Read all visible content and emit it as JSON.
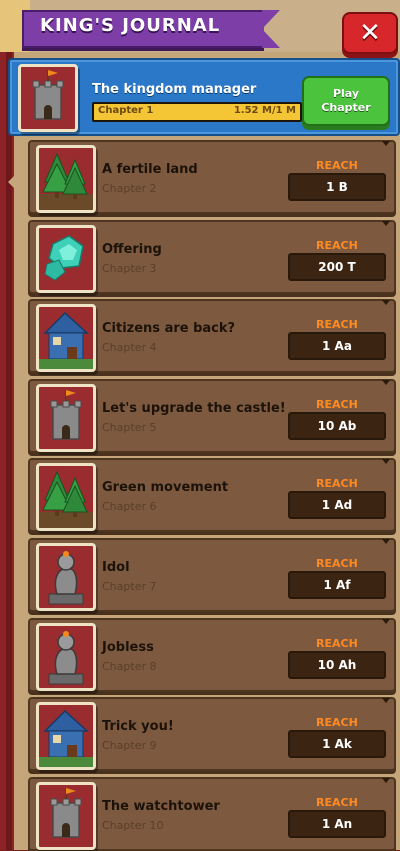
{
  "header": {
    "title": "KING'S JOURNAL",
    "close_icon": "close-icon"
  },
  "active_chapter": {
    "icon": "castle-icon",
    "title": "The kingdom manager",
    "chapter_label": "Chapter 1",
    "progress_text": "1.52 M/1 M",
    "progress_fraction": 1.0,
    "play_label_line1": "Play",
    "play_label_line2": "Chapter"
  },
  "chapters": [
    {
      "title": "A fertile land",
      "chapter": "Chapter 2",
      "reach_label": "REACH",
      "value": "1 B",
      "icon": "trees-icon"
    },
    {
      "title": "Offering",
      "chapter": "Chapter 3",
      "reach_label": "REACH",
      "value": "200 T",
      "icon": "gem-icon"
    },
    {
      "title": "Citizens are back?",
      "chapter": "Chapter 4",
      "reach_label": "REACH",
      "value": "1 Aa",
      "icon": "house-icon"
    },
    {
      "title": "Let's upgrade the castle!",
      "chapter": "Chapter 5",
      "reach_label": "REACH",
      "value": "10 Ab",
      "icon": "castle-icon"
    },
    {
      "title": "Green movement",
      "chapter": "Chapter 6",
      "reach_label": "REACH",
      "value": "1 Ad",
      "icon": "trees-icon"
    },
    {
      "title": "Idol",
      "chapter": "Chapter 7",
      "reach_label": "REACH",
      "value": "1 Af",
      "icon": "statue-icon"
    },
    {
      "title": "Jobless",
      "chapter": "Chapter 8",
      "reach_label": "REACH",
      "value": "10 Ah",
      "icon": "statue-icon"
    },
    {
      "title": "Trick you!",
      "chapter": "Chapter 9",
      "reach_label": "REACH",
      "value": "1 Ak",
      "icon": "house-icon"
    },
    {
      "title": "The watchtower",
      "chapter": "Chapter 10",
      "reach_label": "REACH",
      "value": "1 An",
      "icon": "castle-icon"
    }
  ],
  "colors": {
    "ribbon": "#7d3ea8",
    "close": "#d8272b",
    "active_card": "#2c78c8",
    "play_button": "#4cc33c",
    "card": "#7d5a3f",
    "reach": "#ff8a22",
    "progress": "#f4c534"
  }
}
